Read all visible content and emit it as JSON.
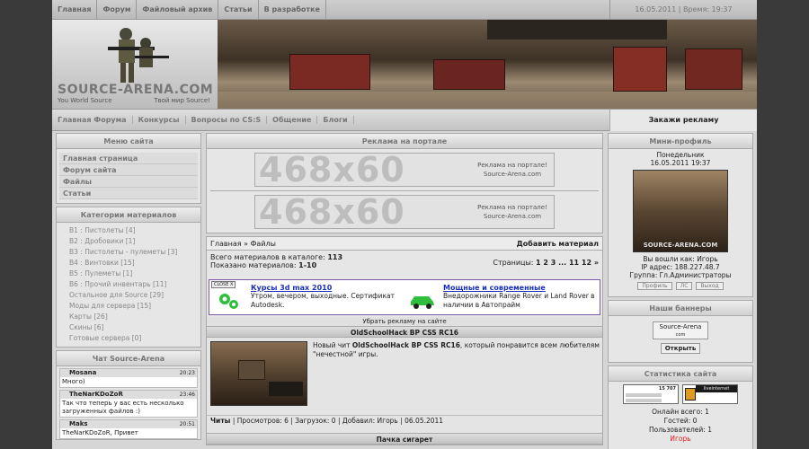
{
  "topnav": {
    "items": [
      "Главная",
      "Форум",
      "Файловый архив",
      "Статьи",
      "В разработке"
    ],
    "date": "16.05.2011 | Время: 19:37"
  },
  "header": {
    "logo_title": "SOURCE-ARENA.COM",
    "logo_sub_left": "You World Source",
    "logo_sub_right": "Твой мир Source!"
  },
  "mainnav": {
    "items": [
      "Главная Форума",
      "Конкурсы",
      "Вопросы по CS:S",
      "Общение",
      "Блоги"
    ],
    "ad": "Закажи рекламу"
  },
  "site_menu": {
    "title": "Меню сайта",
    "items": [
      "Главная страница",
      "Форум сайта",
      "Файлы",
      "Статьи"
    ]
  },
  "categories": {
    "title": "Категории материалов",
    "items": [
      "B1 : Пистолеты [4]",
      "B2 : Дробовики [1]",
      "B3 : Пистолеты - пулеметы [3]",
      "B4 : Винтовки [15]",
      "B5 : Пулеметы [1]",
      "B6 : Прочий инвентарь [11]",
      "Остальное для Source [29]",
      "Моды для сервера [15]",
      "Карты [26]",
      "Скины [6]",
      "Готовые сервера [0]"
    ]
  },
  "chat": {
    "title": "Чат Source-Arena",
    "messages": [
      {
        "user": "Mosana",
        "time": "20:23",
        "text": "Много)"
      },
      {
        "user": "TheNarKDoZoR",
        "time": "23:46",
        "text": "Так что теперь у вас есть несколько загруженных файлов :)"
      },
      {
        "user": "Maks",
        "time": "20:51",
        "text": "TheNarKDoZoR, Привет"
      }
    ]
  },
  "ads": {
    "title": "Реклама на портале",
    "size": "468x60",
    "side": "Реклама на портале! Source-Arena.com"
  },
  "files": {
    "breadcrumb": "Главная » Файлы",
    "add": "Добавить материал",
    "total_label": "Всего материалов в каталоге:",
    "total": "113",
    "shown_label": "Показано материалов:",
    "shown": "1-10",
    "pages_label": "Страницы:",
    "pages": "1 2 3 ... 11 12 »"
  },
  "links": {
    "close": "CLOSE X",
    "ad1_title": "Курсы 3d max 2010",
    "ad1_text": "Утром, вечером, выходные. Сертификат Autodesk.",
    "ad2_title": "Мощные и современные",
    "ad2_text": "Внедорожники Range Rover и Land Rover в наличии в Автопрайм",
    "remove": "Убрать рекламу на сайте"
  },
  "entry1": {
    "title": "OldSchoolHack BP CSS RC16",
    "desc_prefix": "Новый чит ",
    "desc_bold": "OldSchoolHack BP CSS RC16",
    "desc_suffix": ", который понравится всем любителям \"нечестной\" игры.",
    "footer_cat": "Читы",
    "footer_rest": " | Просмотров: 6 | Загрузок: 0 | Добавил: Игорь | 06.05.2011"
  },
  "entry2": {
    "title": "Пачка сигарет"
  },
  "profile": {
    "title": "Мини-профиль",
    "day": "Понедельник",
    "datetime": "16.05.2011 19:37",
    "avatar_text": "SOURCE-ARENA.COM",
    "login": "Вы вошли как: Игорь",
    "ip": "IP адрес: 188.227.48.7",
    "group": "Группа: Гл.Администраторы",
    "buttons": [
      "Профиль",
      "ЛС",
      "Выход"
    ]
  },
  "banners": {
    "title": "Наши баннеры",
    "banner_text": "Source-Arena",
    "banner_sub": "com",
    "open": "Открыть"
  },
  "stats": {
    "title": "Статистика сайта",
    "counter_value": "15 707",
    "counter2": "liveinternet",
    "online": "Онлайн всего: 1",
    "guests": "Гостей: 0",
    "users": "Пользователей: 1",
    "user": "Игорь"
  },
  "colors": {
    "link": "#1a2fbd",
    "online_user": "#e0201a",
    "ad_border": "#7a5aa8"
  }
}
